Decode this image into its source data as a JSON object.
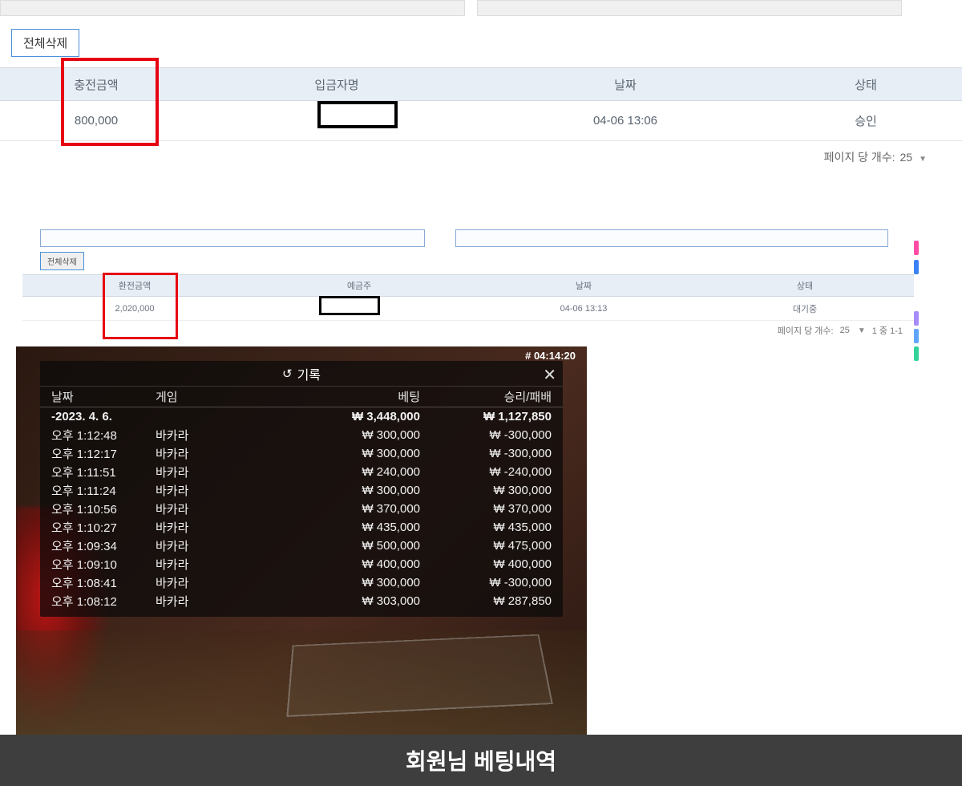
{
  "top": {
    "delete_all": "전체삭제"
  },
  "table1": {
    "headers": {
      "amount": "충전금액",
      "name": "입금자명",
      "date": "날짜",
      "status": "상태"
    },
    "row": {
      "amount": "800,000",
      "name": "",
      "date": "04-06 13:06",
      "status": "승인"
    },
    "pager_label": "페이지 당 개수:",
    "pager_value": "25"
  },
  "section2": {
    "delete_all": "전체삭제",
    "headers": {
      "amount": "환전금액",
      "name": "예금주",
      "date": "날짜",
      "status": "상태"
    },
    "row": {
      "amount": "2,020,000",
      "name": "",
      "date": "04-06 13:13",
      "status": "대기중"
    },
    "pager_label": "페이지 당 개수:",
    "pager_value": "25",
    "pager_range": "1 중 1-1"
  },
  "game": {
    "clock": "# 04:14:20",
    "title": "기록",
    "headers": {
      "date": "날짜",
      "game": "게임",
      "bet": "베팅",
      "winloss": "승리/패배"
    },
    "summary": {
      "date": "-2023. 4. 6.",
      "bet": "₩ 3,448,000",
      "winloss": "₩ 1,127,850"
    },
    "rows": [
      {
        "time": "오후 1:12:48",
        "game": "바카라",
        "bet": "₩ 300,000",
        "winloss": "₩ -300,000"
      },
      {
        "time": "오후 1:12:17",
        "game": "바카라",
        "bet": "₩ 300,000",
        "winloss": "₩ -300,000"
      },
      {
        "time": "오후 1:11:51",
        "game": "바카라",
        "bet": "₩ 240,000",
        "winloss": "₩ -240,000"
      },
      {
        "time": "오후 1:11:24",
        "game": "바카라",
        "bet": "₩ 300,000",
        "winloss": "₩ 300,000"
      },
      {
        "time": "오후 1:10:56",
        "game": "바카라",
        "bet": "₩ 370,000",
        "winloss": "₩ 370,000"
      },
      {
        "time": "오후 1:10:27",
        "game": "바카라",
        "bet": "₩ 435,000",
        "winloss": "₩ 435,000"
      },
      {
        "time": "오후 1:09:34",
        "game": "바카라",
        "bet": "₩ 500,000",
        "winloss": "₩ 475,000"
      },
      {
        "time": "오후 1:09:10",
        "game": "바카라",
        "bet": "₩ 400,000",
        "winloss": "₩ 400,000"
      },
      {
        "time": "오후 1:08:41",
        "game": "바카라",
        "bet": "₩ 300,000",
        "winloss": "₩ -300,000"
      },
      {
        "time": "오후 1:08:12",
        "game": "바카라",
        "bet": "₩ 303,000",
        "winloss": "₩ 287,850"
      }
    ]
  },
  "banner": "회원님 베팅내역"
}
